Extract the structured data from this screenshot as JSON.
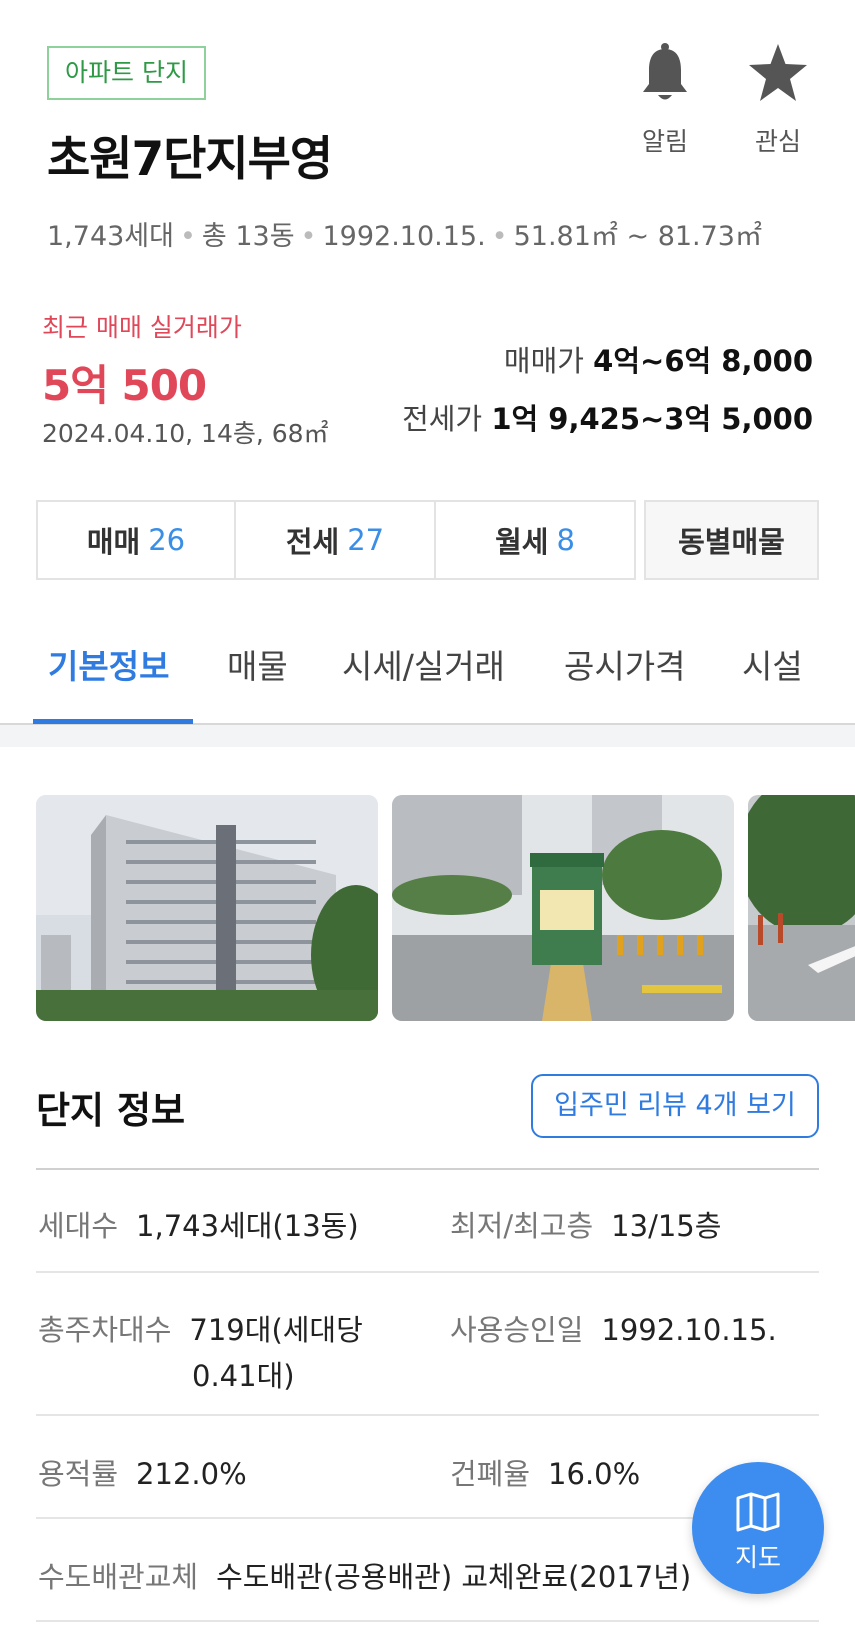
{
  "header": {
    "badge": "아파트 단지",
    "title": "초원7단지부영",
    "actions": [
      {
        "label": "알림",
        "icon": "bell-icon"
      },
      {
        "label": "관심",
        "icon": "star-icon"
      }
    ],
    "meta": [
      "1,743세대",
      "총 13동",
      "1992.10.15.",
      "51.81㎡ ~ 81.73㎡"
    ]
  },
  "recent_trade": {
    "label": "최근 매매 실거래가",
    "price": "5억 500",
    "detail": "2024.04.10, 14층, 68㎡"
  },
  "price_ranges": {
    "sale_label": "매매가",
    "sale_value": "4억~6억 8,000",
    "jeonse_label": "전세가",
    "jeonse_value": "1억 9,425~3억 5,000"
  },
  "listing_counts": [
    {
      "label": "매매",
      "count": "26"
    },
    {
      "label": "전세",
      "count": "27"
    },
    {
      "label": "월세",
      "count": "8"
    }
  ],
  "dong_button": "동별매물",
  "tabs": [
    "기본정보",
    "매물",
    "시세/실거래",
    "공시가격",
    "시설"
  ],
  "active_tab": "기본정보",
  "complex_info": {
    "title": "단지 정보",
    "review_button": "입주민 리뷰 4개 보기",
    "rows": [
      [
        {
          "key": "세대수",
          "value": "1,743세대(13동)"
        },
        {
          "key": "최저/최고층",
          "value": "13/15층"
        }
      ],
      [
        {
          "key": "총주차대수",
          "value": "719대(세대당",
          "value2": "0.41대)"
        },
        {
          "key": "사용승인일",
          "value": "1992.10.15."
        }
      ],
      [
        {
          "key": "용적률",
          "value": "212.0%"
        },
        {
          "key": "건폐율",
          "value": "16.0%"
        }
      ],
      [
        {
          "key": "수도배관교체",
          "value": "수도배관(공용배관) 교체완료(2017년)"
        }
      ]
    ]
  },
  "map_button": {
    "label": "지도",
    "icon": "map-icon"
  },
  "colors": {
    "accent": "#2f7be0",
    "price_red": "#e0485a",
    "badge_green": "#2e9a45"
  }
}
